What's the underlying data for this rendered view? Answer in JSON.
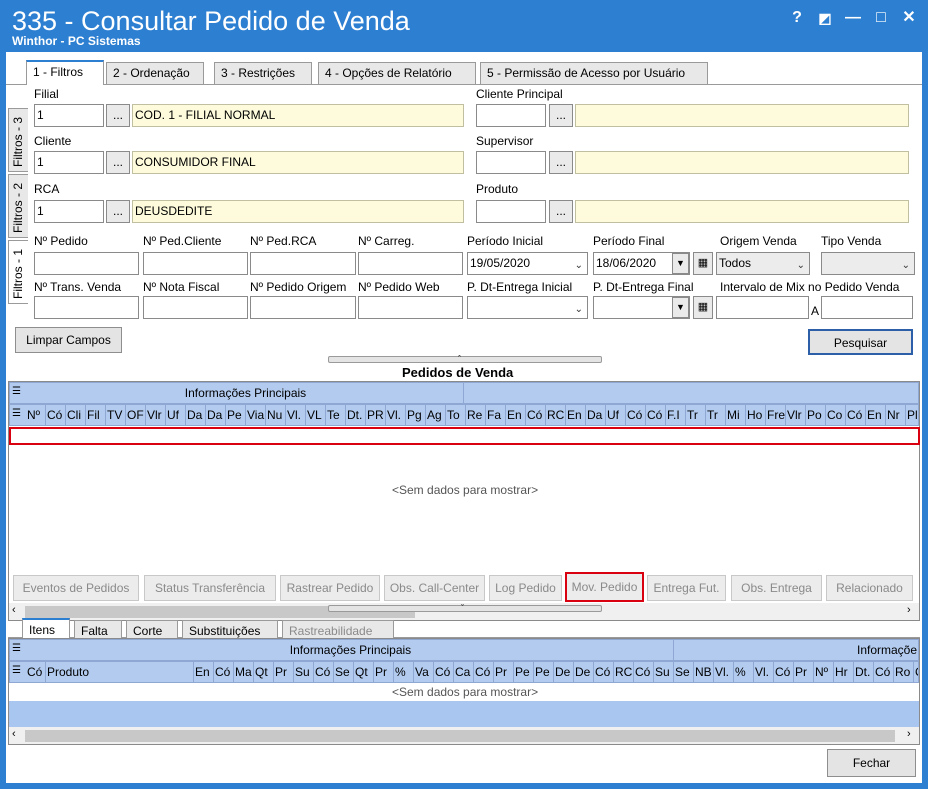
{
  "window": {
    "title": "335 - Consultar Pedido de Venda",
    "subtitle": "Winthor - PC Sistemas",
    "controls": [
      "?",
      "◩",
      "—",
      "□",
      "✕"
    ]
  },
  "tabs": [
    {
      "label": "1 - Filtros",
      "active": true
    },
    {
      "label": "2 - Ordenação",
      "active": false
    },
    {
      "label": "3 - Restrições",
      "active": false
    },
    {
      "label": "4 - Opções de Relatório",
      "active": false
    },
    {
      "label": "5 - Permissão de Acesso por Usuário",
      "active": false
    }
  ],
  "side_tabs": [
    "Filtros - 3",
    "Filtros - 2",
    "Filtros - 1"
  ],
  "filters": {
    "filial": {
      "label": "Filial",
      "code": "1",
      "desc": "COD. 1 - FILIAL NORMAL"
    },
    "cliente": {
      "label": "Cliente",
      "code": "1",
      "desc": "CONSUMIDOR FINAL"
    },
    "rca": {
      "label": "RCA",
      "code": "1",
      "desc": "DEUSDEDITE"
    },
    "cliente_principal": {
      "label": "Cliente Principal",
      "code": "",
      "desc": ""
    },
    "supervisor": {
      "label": "Supervisor",
      "code": "",
      "desc": ""
    },
    "produto": {
      "label": "Produto",
      "code": "",
      "desc": ""
    },
    "dots": "...",
    "row1": {
      "num_pedido": "Nº Pedido",
      "num_ped_cliente": "Nº Ped.Cliente",
      "num_ped_rca": "Nº Ped.RCA",
      "num_carreg": "Nº Carreg.",
      "periodo_inicial": "Período Inicial",
      "periodo_inicial_value": "19/05/2020",
      "periodo_final": "Período Final",
      "periodo_final_value": "18/06/2020",
      "origem_venda": "Origem Venda",
      "origem_venda_value": "Todos",
      "tipo_venda": "Tipo Venda"
    },
    "row2": {
      "num_trans_venda": "Nº Trans. Venda",
      "num_nota_fiscal": "Nº Nota Fiscal",
      "num_pedido_origem": "Nº Pedido Origem",
      "num_pedido_web": "Nº Pedido Web",
      "dt_entrega_inicial": "P. Dt-Entrega Inicial",
      "dt_entrega_final": "P. Dt-Entrega Final",
      "intervalo_mix": "Intervalo de Mix no Pedido Venda",
      "a": "A"
    }
  },
  "buttons": {
    "limpar": "Limpar Campos",
    "pesquisar": "Pesquisar",
    "fechar": "Fechar"
  },
  "pedidos": {
    "section_title": "Pedidos de  Venda",
    "group_header": "Informações Principais",
    "columns": [
      "Nº",
      "Có",
      "Cli",
      "Fil",
      "TV",
      "OF",
      "Vlr",
      "Uf",
      "Da",
      "Da",
      "Pe",
      "Via",
      "Nu",
      "Vl.",
      "VL",
      "Te",
      "Dt.",
      "PR",
      "Vl.",
      "Pg",
      "Ag",
      "To",
      "Re",
      "Fa",
      "En",
      "Có",
      "RC",
      "En",
      "Da",
      "Uf",
      "Có",
      "Có",
      "F.I",
      "Tr",
      "Tr",
      "Mi",
      "Ho",
      "Fre",
      "Vlr",
      "Po",
      "Co",
      "Có",
      "En",
      "Nr",
      "Pla"
    ],
    "empty": "<Sem dados para mostrar>"
  },
  "action_buttons": [
    {
      "label": "Eventos de Pedidos"
    },
    {
      "label": "Status Transferência"
    },
    {
      "label": "Rastrear Pedido"
    },
    {
      "label": "Obs. Call-Center"
    },
    {
      "label": "Log Pedido"
    },
    {
      "label": "Mov. Pedido"
    },
    {
      "label": "Entrega Fut."
    },
    {
      "label": "Obs. Entrega"
    },
    {
      "label": "Relacionado"
    }
  ],
  "bottom_tabs": [
    {
      "label": "Itens",
      "active": true
    },
    {
      "label": "Falta",
      "active": false
    },
    {
      "label": "Corte",
      "active": false
    },
    {
      "label": "Substituições",
      "active": false
    },
    {
      "label": "Rastreabilidade",
      "active": false
    }
  ],
  "itens": {
    "group_header_1": "Informações Principais",
    "group_header_2": "Informaçõe",
    "columns_first": [
      "Có",
      "Produto"
    ],
    "columns": [
      "En",
      "Có",
      "Ma",
      "Qt",
      "Pr",
      "Su",
      "Có",
      "Se",
      "Qt",
      "Pr",
      "%",
      "Va",
      "Có",
      "Ca",
      "Có",
      "Pr",
      "Pe",
      "Pe",
      "De",
      "De",
      "Có",
      "RC",
      "Có",
      "Su",
      "Se",
      "NB",
      "Vl.",
      "%",
      "Vl.",
      "Có",
      "Pr",
      "Nº",
      "Hr",
      "Dt.",
      "Có",
      "Ro",
      "Ca"
    ],
    "empty": "<Sem dados para mostrar>"
  },
  "colors": {
    "title_bg": "#2d7fd1",
    "grid_header": "#b2cbef",
    "highlight": "#d9000f",
    "yellow_field": "#fdfbdb"
  }
}
